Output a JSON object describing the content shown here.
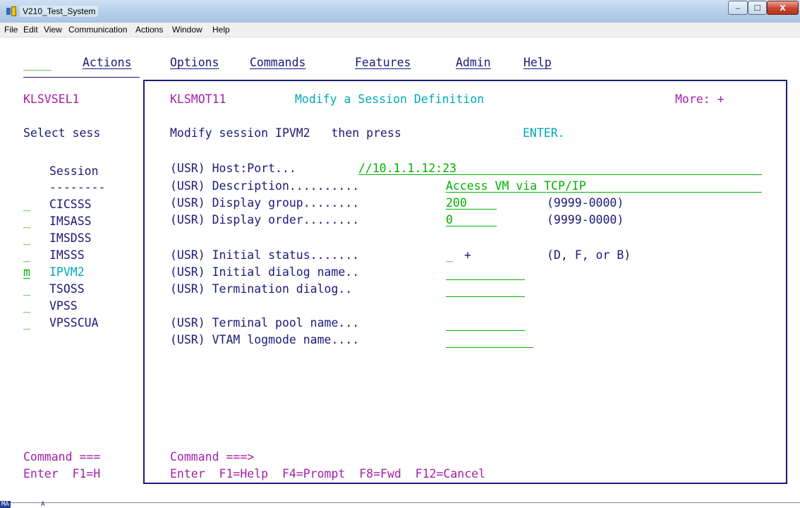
{
  "window": {
    "title": "V210_Test_System",
    "minimize_glyph": "‒",
    "maximize_glyph": "☐",
    "close_glyph": "X"
  },
  "menubar": {
    "file": "File",
    "edit": "Edit",
    "view": "View",
    "communication": "Communication",
    "actions": "Actions",
    "window": "Window",
    "help": "Help"
  },
  "pulldown": {
    "input_value": "____",
    "actions": "Actions",
    "options": "Options",
    "commands": "Commands",
    "features": "Features",
    "admin": "Admin",
    "help": "Help"
  },
  "background_panel": {
    "panel_id": "KLSVSEL1",
    "prompt": "Select sess",
    "column_header": "Session",
    "column_rule": "--------",
    "rows": [
      {
        "selector": "_",
        "name": "CICSSS"
      },
      {
        "selector": "_",
        "name": "IMSASS"
      },
      {
        "selector": "_",
        "name": "IMSDSS"
      },
      {
        "selector": "_",
        "name": "IMSSS"
      },
      {
        "selector": "m",
        "name": "IPVM2"
      },
      {
        "selector": "_",
        "name": "TSOSS"
      },
      {
        "selector": "_",
        "name": "VPSS"
      },
      {
        "selector": "_",
        "name": "VPSSCUA"
      }
    ],
    "command_label": "Command ===",
    "pfkeys": "Enter  F1=H"
  },
  "popup": {
    "panel_id": "KLSMOT11",
    "title": "Modify a Session Definition",
    "more": "More: +",
    "instruction_prefix": "Modify session IPVM2   then press ",
    "instruction_key": "ENTER.",
    "fields": {
      "host_port": {
        "label": "(USR) Host:Port... ",
        "value": "//10.1.1.12:23"
      },
      "description": {
        "label": "(USR) Description.......... ",
        "value": "Access VM via TCP/IP"
      },
      "display_group": {
        "label": "(USR) Display group........ ",
        "value": "200",
        "hint": "(9999-0000)"
      },
      "display_order": {
        "label": "(USR) Display order........ ",
        "value": "0",
        "hint": "(9999-0000)"
      },
      "initial_status": {
        "label": "(USR) Initial status....... ",
        "value": "_",
        "prompt_marker": "+",
        "hint": "(D, F, or B)"
      },
      "initial_dialog": {
        "label": "(USR) Initial dialog name.. ",
        "value": ""
      },
      "termination_dialog": {
        "label": "(USR) Termination dialog.. ",
        "value": ""
      },
      "terminal_pool": {
        "label": "(USR) Terminal pool name... ",
        "value": ""
      },
      "vtam_logmode": {
        "label": "(USR) VTAM logmode name.... ",
        "value": ""
      }
    },
    "command_label": "Command ===>",
    "pfkeys": "Enter  F1=Help  F4=Prompt  F8=Fwd  F12=Cancel"
  },
  "status": {
    "mode": "MA",
    "indicator": "A"
  },
  "colors": {
    "magenta": "#a41fa8",
    "blue": "#1a1a78",
    "cyan": "#00a9b4",
    "green": "#00b300"
  }
}
